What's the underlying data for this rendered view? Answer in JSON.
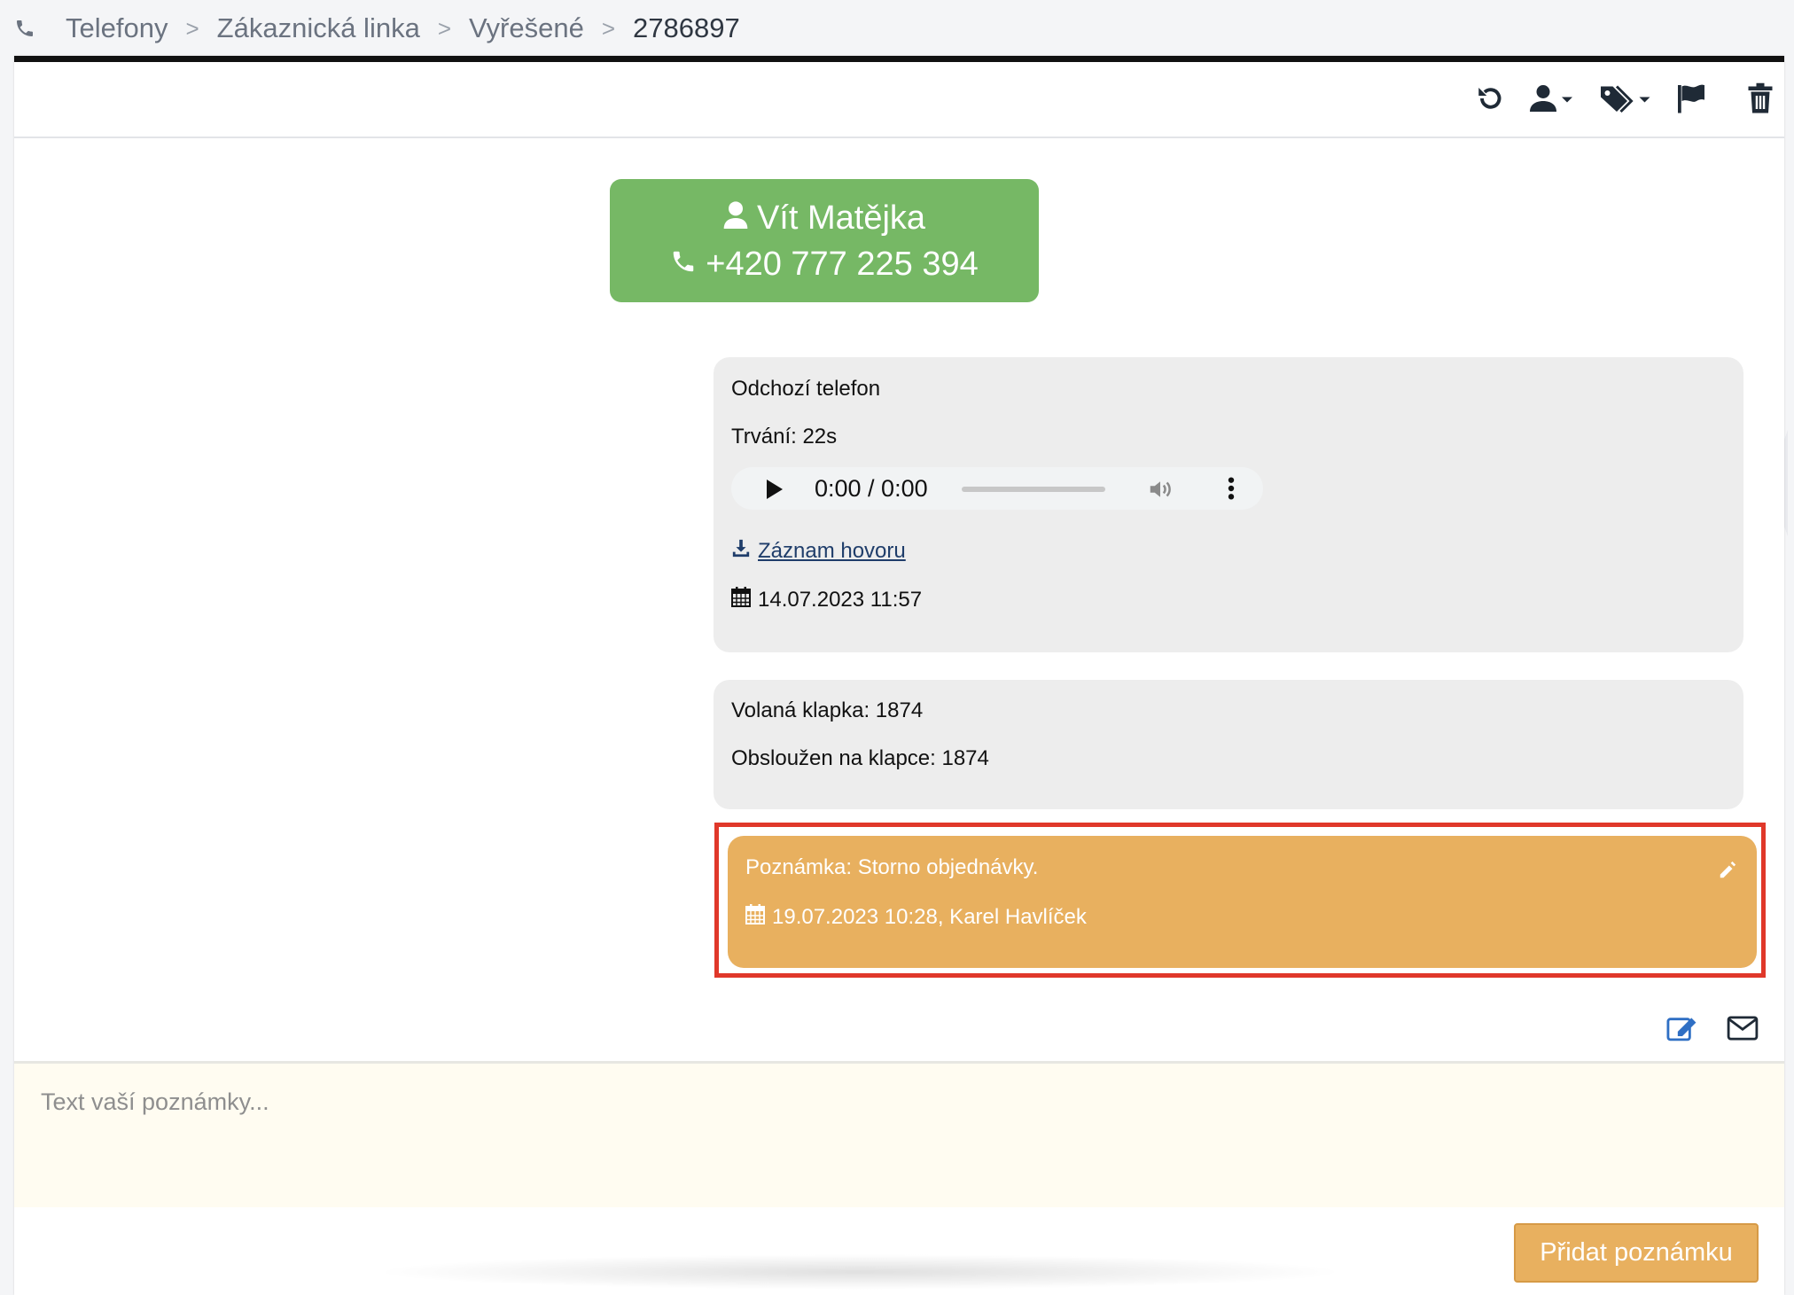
{
  "breadcrumb": {
    "items": [
      "Telefony",
      "Zákaznická linka",
      "Vyřešené"
    ],
    "current": "2786897",
    "separator": ">"
  },
  "toolbar": {
    "icons": [
      "refresh-icon",
      "assign-user-icon",
      "tags-icon",
      "flag-icon",
      "trash-icon"
    ]
  },
  "contact": {
    "name": "Vít Matějka",
    "phone": "+420 777 225 394",
    "color": "#76b865"
  },
  "call": {
    "type": "Odchozí telefon",
    "duration": "Trvání: 22s",
    "audio_time": "0:00 / 0:00",
    "recording_link": " Záznam hovoru",
    "date": " 14.07.2023 11:57"
  },
  "extension": {
    "called": "Volaná klapka: 1874",
    "served": "Obsloužen na klapce: 1874"
  },
  "note": {
    "text": "Poznámka: Storno objednávky.",
    "meta": " 19.07.2023 10:28, Karel Havlíček",
    "color": "#e8b05f",
    "highlight_color": "#e0382a"
  },
  "composer": {
    "placeholder": "Text vaší poznámky...",
    "submit_label": "Přidat poznámku"
  }
}
